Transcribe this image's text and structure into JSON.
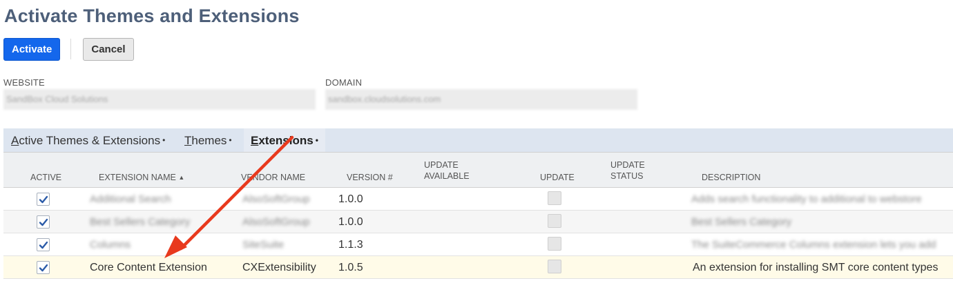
{
  "page": {
    "title": "Activate Themes and Extensions"
  },
  "toolbar": {
    "activate_label": "Activate",
    "cancel_label": "Cancel"
  },
  "fields": {
    "website": {
      "label": "WEBSITE",
      "value": "SandBox Cloud Solutions"
    },
    "domain": {
      "label": "DOMAIN",
      "value": "sandbox.cloudsolutions.com"
    }
  },
  "tabs": [
    {
      "prefix": "",
      "underline": "A",
      "rest": "ctive Themes & Extensions",
      "dot": "•"
    },
    {
      "prefix": "",
      "underline": "T",
      "rest": "hemes",
      "dot": "•"
    },
    {
      "prefix": "",
      "underline": "E",
      "rest": "xtensions",
      "dot": "•"
    }
  ],
  "table": {
    "columns": {
      "active": "ACTIVE",
      "name": "EXTENSION NAME",
      "sort_indicator": "▲",
      "vendor": "VENDOR NAME",
      "version": "VERSION #",
      "update_available_1": "UPDATE",
      "update_available_2": "AVAILABLE",
      "update": "UPDATE",
      "update_status_1": "UPDATE",
      "update_status_2": "STATUS",
      "description": "DESCRIPTION"
    },
    "rows": [
      {
        "active": true,
        "name": "Additional Search",
        "vendor": "AlsoSoftGroup",
        "version": "1.0.0",
        "description": "Adds search functionality to additional to webstore"
      },
      {
        "active": true,
        "name": "Best Sellers Category",
        "vendor": "AlsoSoftGroup",
        "version": "1.0.0",
        "description": "Best Sellers Category"
      },
      {
        "active": true,
        "name": "Columns",
        "vendor": "SiteSuite",
        "version": "1.1.3",
        "description": "The SuiteCommerce Columns extension lets you add"
      },
      {
        "active": true,
        "name": "Core Content Extension",
        "vendor": "CXExtensibility",
        "version": "1.0.5",
        "description": "An extension for installing SMT core content types"
      }
    ]
  },
  "annotation": {
    "arrow_color": "#e8391d"
  }
}
